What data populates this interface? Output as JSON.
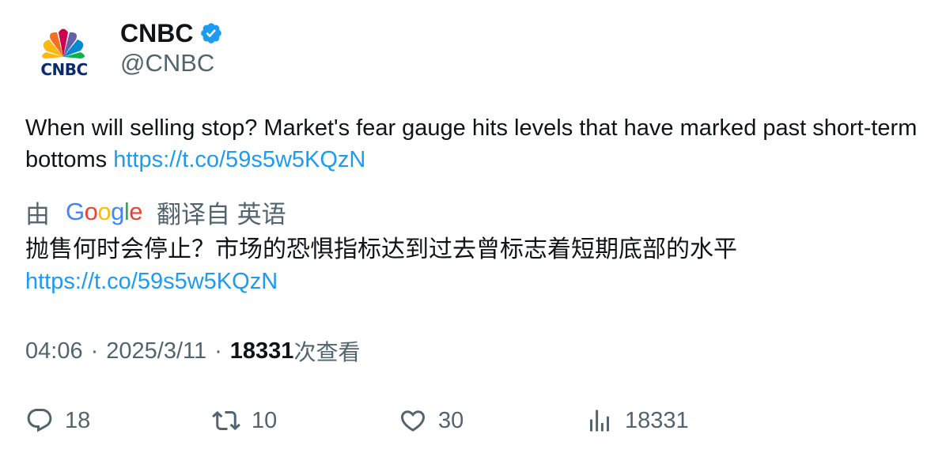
{
  "author": {
    "display_name": "CNBC",
    "handle": "@CNBC",
    "avatar_text": "CNBC",
    "verified_icon": "verified-badge-icon",
    "colors": {
      "verified": "#1d9bf0"
    }
  },
  "tweet": {
    "text": "When will selling stop? Market's fear gauge hits levels that have marked past short-term bottoms ",
    "link": "https://t.co/59s5w5KQzN"
  },
  "translation": {
    "prefix": "由",
    "provider": "Google",
    "suffix": "翻译自 英语",
    "text": "抛售何时会停止？市场的恐惧指标达到过去曾标志着短期底部的水平",
    "link": "https://t.co/59s5w5KQzN"
  },
  "meta": {
    "time": "04:06",
    "separator": "·",
    "date": "2025/3/11",
    "views_count": "18331",
    "views_label": "次查看"
  },
  "actions": [
    {
      "icon": "reply-icon",
      "count": "18"
    },
    {
      "icon": "retweet-icon",
      "count": "10"
    },
    {
      "icon": "like-icon",
      "count": "30"
    },
    {
      "icon": "views-icon",
      "count": "18331"
    }
  ],
  "colors": {
    "link": "#1d9bf0",
    "secondary_text": "#536471",
    "primary_text": "#0f1419"
  }
}
